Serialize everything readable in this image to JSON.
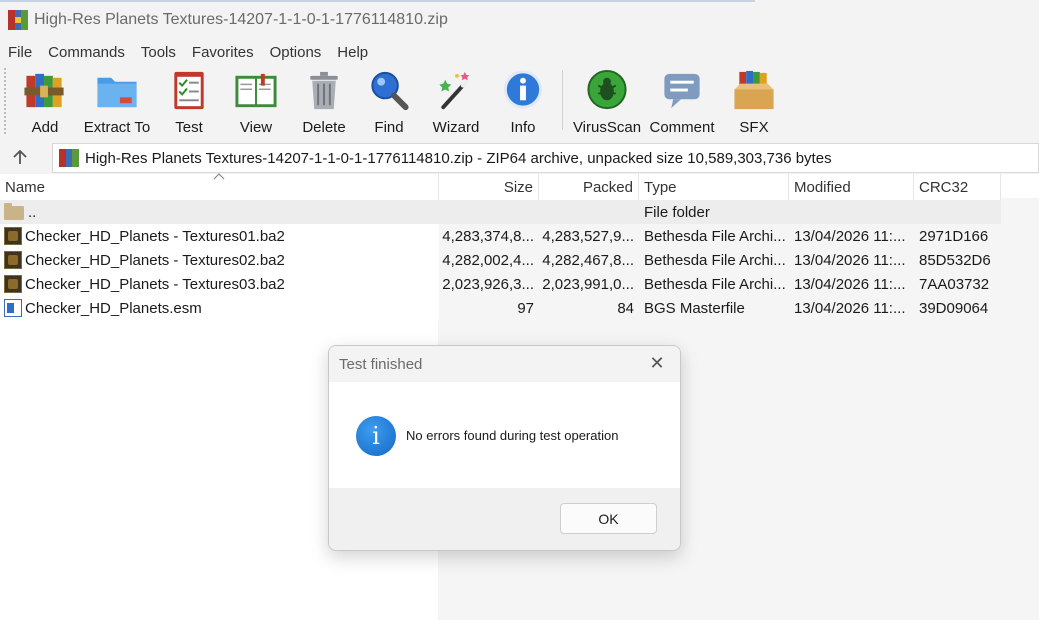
{
  "window": {
    "title": "High-Res Planets Textures-14207-1-1-0-1-1776114810.zip"
  },
  "menu": [
    "File",
    "Commands",
    "Tools",
    "Favorites",
    "Options",
    "Help"
  ],
  "toolbar": {
    "add": "Add",
    "extract": "Extract To",
    "test": "Test",
    "view": "View",
    "delete": "Delete",
    "find": "Find",
    "wizard": "Wizard",
    "info": "Info",
    "virusscan": "VirusScan",
    "comment": "Comment",
    "sfx": "SFX"
  },
  "address": {
    "path": "High-Res Planets Textures-14207-1-1-0-1-1776114810.zip - ZIP64 archive, unpacked size 10,589,303,736 bytes"
  },
  "columns": {
    "name": "Name",
    "size": "Size",
    "packed": "Packed",
    "type": "Type",
    "modified": "Modified",
    "crc": "CRC32"
  },
  "files": [
    {
      "name": "..",
      "size": "",
      "packed": "",
      "type": "File folder",
      "modified": "",
      "crc": ""
    },
    {
      "name": "Checker_HD_Planets - Textures01.ba2",
      "size": "4,283,374,8...",
      "packed": "4,283,527,9...",
      "type": "Bethesda File Archi...",
      "modified": "13/04/2026 11:...",
      "crc": "2971D166"
    },
    {
      "name": "Checker_HD_Planets - Textures02.ba2",
      "size": "4,282,002,4...",
      "packed": "4,282,467,8...",
      "type": "Bethesda File Archi...",
      "modified": "13/04/2026 11:...",
      "crc": "85D532D6"
    },
    {
      "name": "Checker_HD_Planets - Textures03.ba2",
      "size": "2,023,926,3...",
      "packed": "2,023,991,0...",
      "type": "Bethesda File Archi...",
      "modified": "13/04/2026 11:...",
      "crc": "7AA03732"
    },
    {
      "name": "Checker_HD_Planets.esm",
      "size": "97",
      "packed": "84",
      "type": "BGS Masterfile",
      "modified": "13/04/2026 11:...",
      "crc": "39D09064"
    }
  ],
  "dialog": {
    "title": "Test finished",
    "close": "✕",
    "message": "No errors found during test operation",
    "ok": "OK"
  },
  "icons": {
    "up": "up-arrow-icon"
  }
}
